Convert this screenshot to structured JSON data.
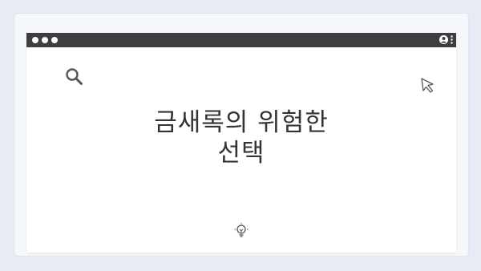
{
  "pager": {
    "count": 4
  },
  "window": {
    "controls": [
      "window-dot",
      "window-dot",
      "window-dot"
    ],
    "user_menu": {
      "icons": [
        "user-icon",
        "kebab-menu-icon"
      ]
    }
  },
  "slide": {
    "title_line1": "금새록의 위험한",
    "title_line2": "선택"
  },
  "icons": {
    "search": "search-icon",
    "cursor": "cursor-icon",
    "idea": "lightbulb-icon"
  },
  "colors": {
    "background": "#e6ebf4",
    "titlebar": "#3e3e3e",
    "text": "#333333",
    "icon_stroke": "#555555"
  }
}
